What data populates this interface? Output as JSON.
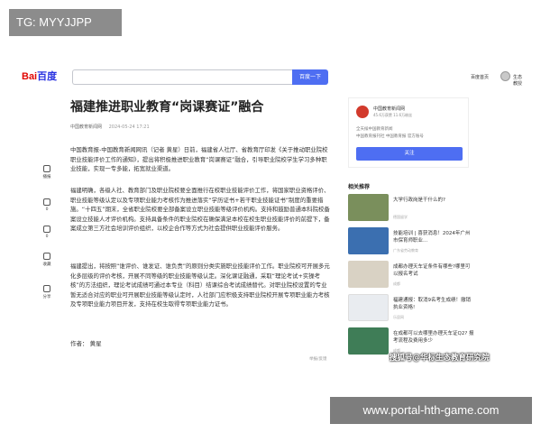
{
  "overlay": {
    "tg": "TG: MYYJJPP",
    "url": "www.portal-hth-game.com",
    "watermark": "搜狐号@华标生态教育研究院"
  },
  "header": {
    "logo_text": "Bai",
    "logo_text2": "百度",
    "search_button": "百度一下",
    "home_link": "百度首页",
    "user_name": "生态教授"
  },
  "article": {
    "title": "福建推进职业教育“岗课赛证”融合",
    "source": "中国教育新闻网",
    "date": "2024-05-24 17:21",
    "paragraphs": [
      "中国教育报-中国教育新闻网讯（记者 黄星）日前，福建省人社厅、省教育厅印发《关于推动职业院校职业技能评价工作的通知》，提出将积极推进职业教育“岗课赛证”融合，引导职业院校学生学习多种职业技能，实现一专多能，拓宽就业渠道。",
      "福建明确，各级人社、教育部门及职业院校要全面推行在校职业技能评价工作，将国家职业资格评价、职业技能等级认定以及专项职业能力考核作为推进落实“学历证书+若干职业技能证书”制度的重要措施。“十四五”期末，全省职业院校要全部备案设立职业技能等级评价机构。支持和鼓励普通本科院校备案设立技能人才评价机构。支持具备条件的职业院校在确保满足本校在校生职业技能评价的前提下，备案成立第三方社会培训评价组织，以校企合作等方式为社会提供职业技能评价服务。",
      "福建提出，将按照“谁评价、谁发证、谁负责”的原则分类实施职业技能评价工作。职业院校可开展多元化多层级的评价考核，开展不同等级的职业技能等级认定。深化课证融通，采取“理论考试+实操考核”的方法组织，理论考试成绩可通过本专业（科目）结课综合考试成绩替代。对职业院校设置的专业暂无适合对应的职业可开展职业技能等级认定时，人社部门应积极支持职业院校开展专项职业能力考核及专项职业能力项目开发，支持在校生取得专项职业能力证书。"
    ],
    "author": "作者：  黄星",
    "report": "举报/反馈"
  },
  "rail": [
    {
      "label": "播报",
      "icon": "speaker-icon"
    },
    {
      "label": "0",
      "icon": "thumb-up-icon"
    },
    {
      "label": "0",
      "icon": "comment-icon"
    },
    {
      "label": "收藏",
      "icon": "star-icon"
    },
    {
      "label": "分享",
      "icon": "share-icon"
    }
  ],
  "author_card": {
    "name": "中国教育新闻网",
    "stats": "45.6万获赞  11.6万粉丝",
    "desc1": "全天候中国教育新闻",
    "desc2": "中国教育报刊社 中国教育报 官方账号",
    "follow": "关注"
  },
  "related": {
    "title": "相关推荐",
    "items": [
      {
        "text": "大学行政岗是干什么的?",
        "source": "德国留学",
        "color": "#7a8f5c"
      },
      {
        "text": "技能培训 | 喜获消息！2024年广州市保育师职业...",
        "source": "广东省劳动教育",
        "color": "#3b6fb0"
      },
      {
        "text": "成都办理天车证条件有哪些?哪里可以报名考试",
        "source": "成都",
        "color": "#d9d2c4"
      },
      {
        "text": "福建通报：取消9名考生成绩！撤销执业资格!",
        "source": "乐居网",
        "color": "#e9ecf0"
      },
      {
        "text": "在成都可以去哪里办理天车证Q2? 报考流程及费用多少",
        "source": "成都",
        "color": "#3f7d57"
      }
    ]
  }
}
